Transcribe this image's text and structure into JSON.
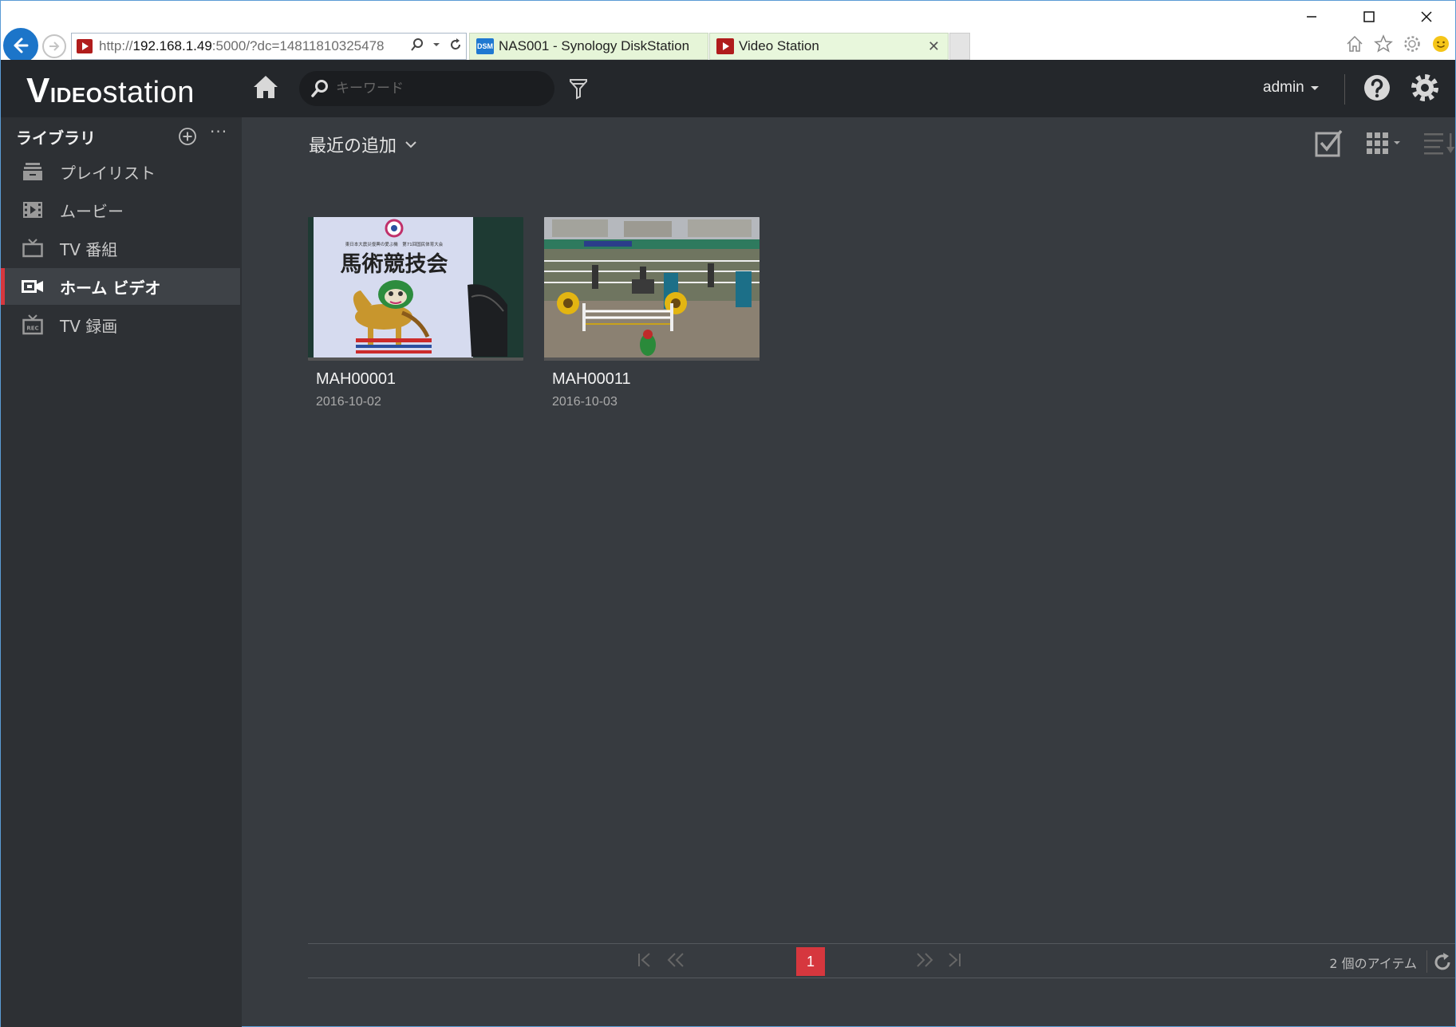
{
  "browser": {
    "url_prefix": "http://",
    "url_host": "192.168.1.49",
    "url_rest": ":5000/?dc=14811810325478",
    "tabs": [
      {
        "label": "NAS001 - Synology DiskStation",
        "icon": "dsm-icon",
        "icon_text": "DSM"
      },
      {
        "label": "Video Station",
        "icon": "video-station-icon"
      }
    ]
  },
  "app": {
    "logo_v": "V",
    "logo_ideo": "IDEO",
    "logo_station": "station",
    "search_placeholder": "キーワード",
    "user": "admin"
  },
  "sidebar": {
    "title": "ライブラリ",
    "more": "···",
    "items": [
      {
        "label": "プレイリスト",
        "icon": "playlist-icon"
      },
      {
        "label": "ムービー",
        "icon": "movie-icon"
      },
      {
        "label": "TV 番組",
        "icon": "tv-icon"
      },
      {
        "label": "ホーム ビデオ",
        "icon": "home-video-icon",
        "active": true
      },
      {
        "label": "TV 録画",
        "icon": "tv-record-icon"
      }
    ]
  },
  "main": {
    "view_title": "最近の追加",
    "videos": [
      {
        "title": "MAH00001",
        "date": "2016-10-02",
        "thumb_text": "馬術競技会",
        "thumb_small": "東日本大震災復興の愛ぶ機　第71回国民体育大会"
      },
      {
        "title": "MAH00011",
        "date": "2016-10-03"
      }
    ],
    "pager": {
      "current_page": "1",
      "item_count": "2 個のアイテム"
    }
  },
  "colors": {
    "accent": "#d6373e",
    "topbar": "#24272b",
    "sidebar": "#2d3034",
    "content": "#373b40"
  }
}
